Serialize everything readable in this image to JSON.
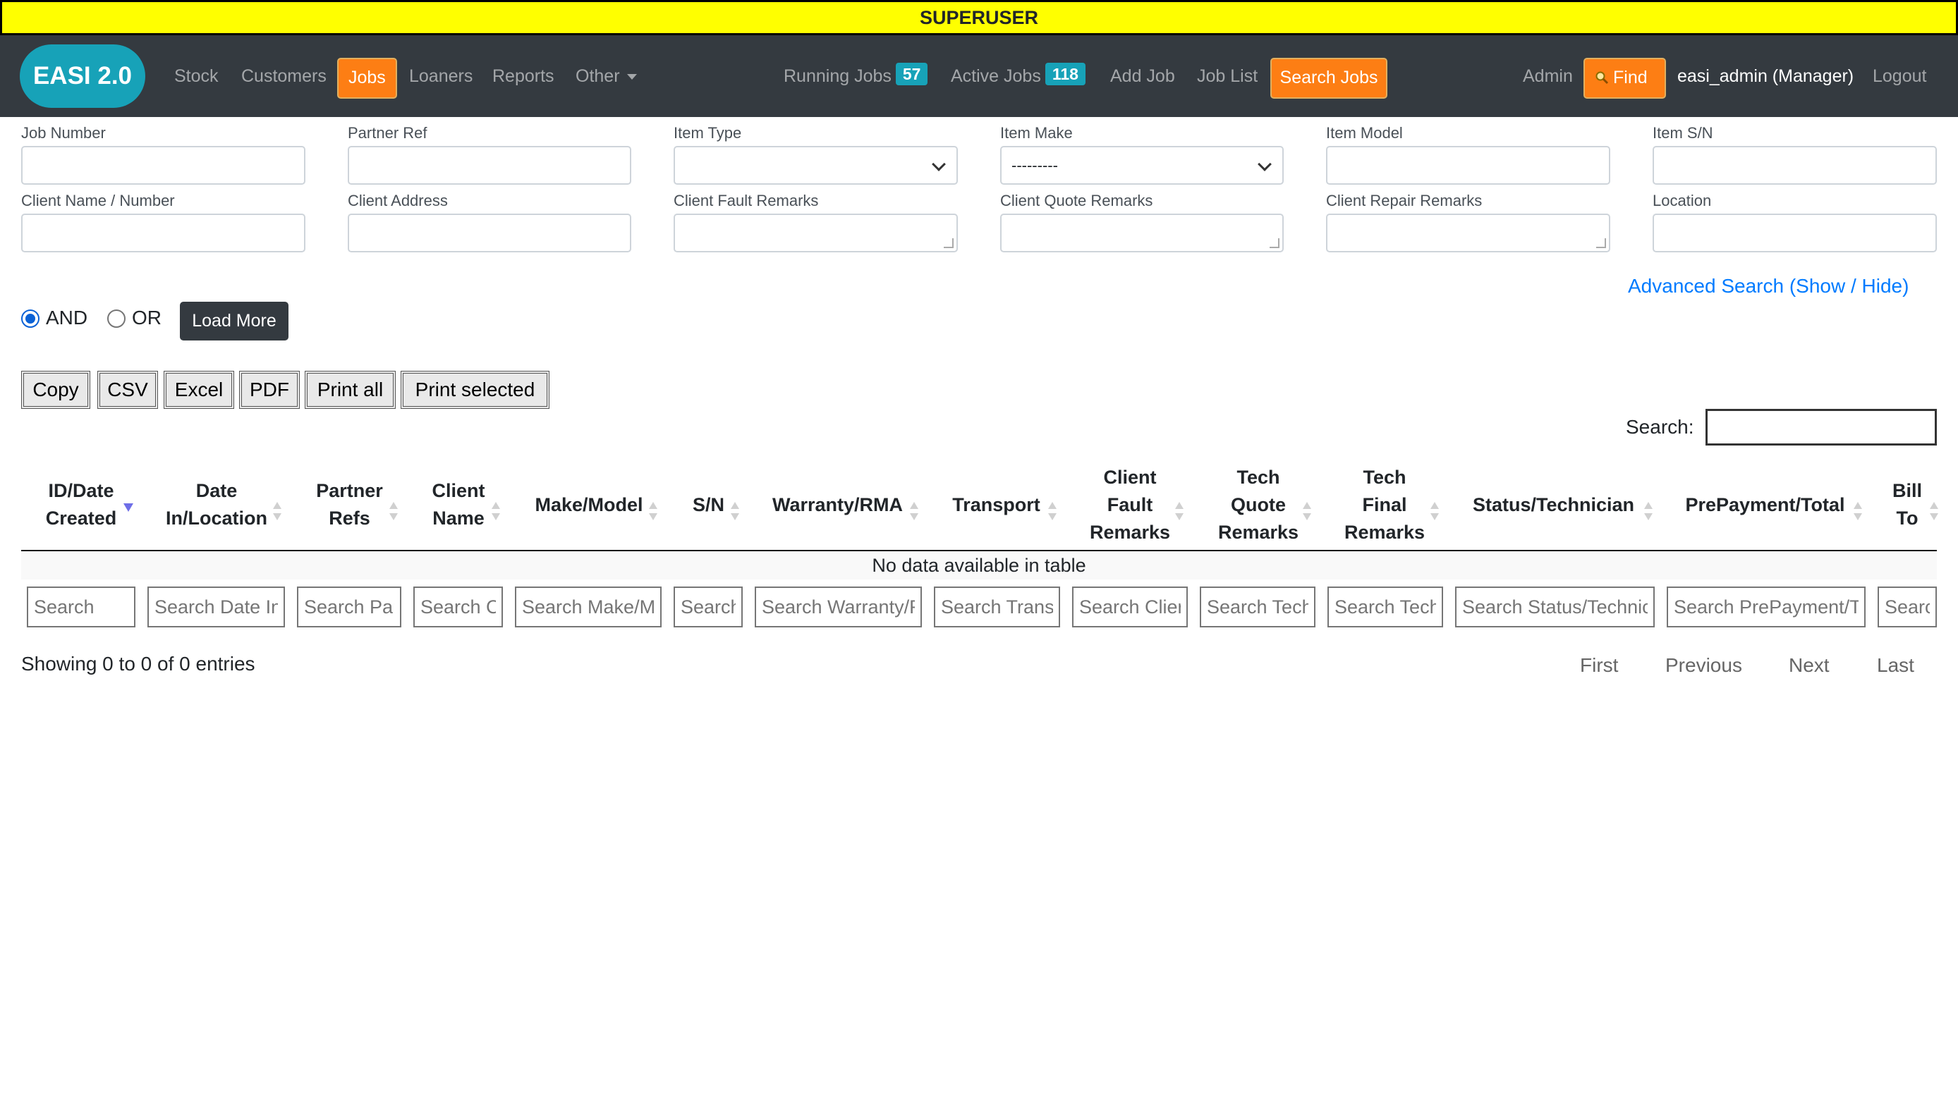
{
  "banner": "SUPERUSER",
  "brand": "EASI 2.0",
  "nav": {
    "stock": "Stock",
    "customers": "Customers",
    "jobs": "Jobs",
    "loaners": "Loaners",
    "reports": "Reports",
    "other": "Other",
    "running_jobs": "Running Jobs",
    "running_jobs_count": "57",
    "active_jobs": "Active Jobs",
    "active_jobs_count": "118",
    "add_job": "Add Job",
    "job_list": "Job List",
    "search_jobs": "Search Jobs",
    "admin": "Admin",
    "find": "Find",
    "user": "easi_admin (Manager)",
    "logout": "Logout"
  },
  "form": {
    "job_number": "Job Number",
    "partner_ref": "Partner Ref",
    "item_type": "Item Type",
    "item_type_value": "",
    "item_make": "Item Make",
    "item_make_value": "---------",
    "item_model": "Item Model",
    "item_sn": "Item S/N",
    "client_name": "Client Name / Number",
    "client_address": "Client Address",
    "client_fault_remarks": "Client Fault Remarks",
    "client_quote_remarks": "Client Quote Remarks",
    "client_repair_remarks": "Client Repair Remarks",
    "location": "Location"
  },
  "advanced_search": "Advanced Search (Show / Hide)",
  "logic": {
    "and": "AND",
    "or": "OR",
    "selected": "AND"
  },
  "load_more": "Load More",
  "export_buttons": {
    "copy": "Copy",
    "csv": "CSV",
    "excel": "Excel",
    "pdf": "PDF",
    "print_all": "Print all",
    "print_selected": "Print selected"
  },
  "table": {
    "search_label": "Search:",
    "columns": [
      "ID/Date Created",
      "Date In/Location",
      "Partner Refs",
      "Client Name",
      "Make/Model",
      "S/N",
      "Warranty/RMA",
      "Transport",
      "Client Fault Remarks",
      "Tech Quote Remarks",
      "Tech Final Remarks",
      "Status/Technician",
      "PrePayment/Total",
      "Bill To"
    ],
    "sorted_column": "ID/Date Created",
    "sort_direction": "descending",
    "empty_message": "No data available in table",
    "column_search_placeholders": [
      "Search",
      "Search Date In",
      "Search Par",
      "Search C",
      "Search Make/M",
      "Search",
      "Search Warranty/R",
      "Search Trans",
      "Search Clier",
      "Search Tech",
      "Search Tech",
      "Search Status/Technic",
      "Search PrePayment/T",
      "Search"
    ]
  },
  "footer": {
    "info": "Showing 0 to 0 of 0 entries",
    "first": "First",
    "previous": "Previous",
    "next": "Next",
    "last": "Last"
  },
  "colors": {
    "accent": "#fd7e14",
    "navbar": "#343a40",
    "badge": "#17a2b8",
    "banner": "#ffff00",
    "link": "#007bff"
  }
}
